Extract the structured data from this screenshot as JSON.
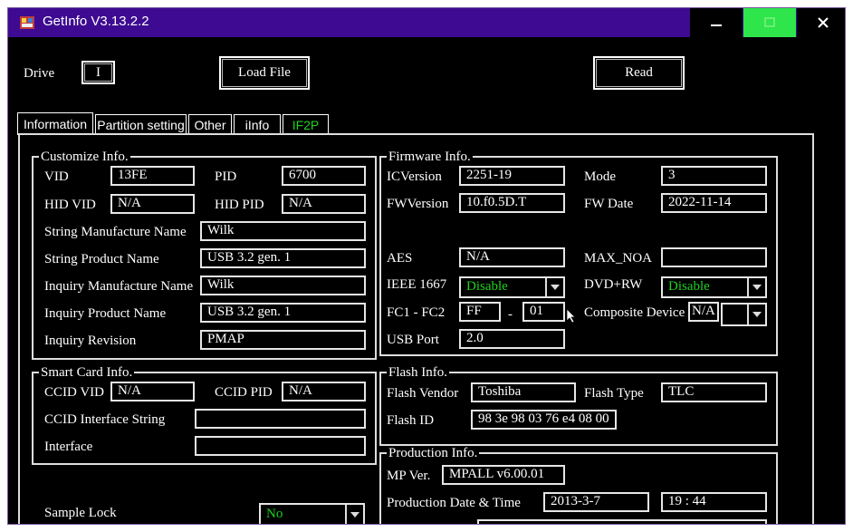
{
  "window": {
    "title": "GetInfo V3.13.2.2"
  },
  "toolbar": {
    "drive_label": "Drive",
    "drive_value": "I",
    "load_file_label": "Load File",
    "read_label": "Read"
  },
  "tabs": [
    "Information",
    "Partition setting",
    "Other",
    "iInfo",
    "IF2P"
  ],
  "customize": {
    "title": "Customize Info.",
    "vid_label": "VID",
    "vid": "13FE",
    "pid_label": "PID",
    "pid": "6700",
    "hid_vid_label": "HID VID",
    "hid_vid": "N/A",
    "hid_pid_label": "HID PID",
    "hid_pid": "N/A",
    "string_mfr_label": "String Manufacture Name",
    "string_mfr": "Wilk",
    "string_product_label": "String Product Name",
    "string_product": "USB 3.2 gen. 1",
    "inquiry_mfr_label": "Inquiry Manufacture Name",
    "inquiry_mfr": "Wilk",
    "inquiry_product_label": "Inquiry Product Name",
    "inquiry_product": "USB 3.2 gen. 1",
    "inquiry_rev_label": "Inquiry Revision",
    "inquiry_rev": "PMAP"
  },
  "firmware": {
    "title": "Firmware Info.",
    "icversion_label": "ICVersion",
    "icversion": "2251-19",
    "mode_label": "Mode",
    "mode": "3",
    "fwversion_label": "FWVersion",
    "fwversion": "10.f0.5D.T",
    "fwdate_label": "FW Date",
    "fwdate": "2022-11-14",
    "aes_label": "AES",
    "aes": "N/A",
    "max_noa_label": "MAX_NOA",
    "max_noa": "",
    "ieee_label": "IEEE 1667",
    "ieee": "Disable",
    "dvdrw_label": "DVD+RW",
    "dvdrw": "Disable",
    "fc_label": "FC1 - FC2",
    "fc1": "FF",
    "fc_sep": "-",
    "fc2": "01",
    "composite_label": "Composite Device",
    "composite": "N/A",
    "composite_combo": "",
    "usbport_label": "USB Port",
    "usbport": "2.0"
  },
  "smartcard": {
    "title": "Smart Card Info.",
    "ccid_vid_label": "CCID VID",
    "ccid_vid": "N/A",
    "ccid_pid_label": "CCID PID",
    "ccid_pid": "N/A",
    "ccid_if_label": "CCID Interface String",
    "ccid_if": "",
    "interface_label": "Interface",
    "interface": ""
  },
  "flash": {
    "title": "Flash Info.",
    "vendor_label": "Flash Vendor",
    "vendor": "Toshiba",
    "type_label": "Flash Type",
    "type": "TLC",
    "id_label": "Flash ID",
    "id": "98 3e 98 03 76 e4 08 00"
  },
  "production": {
    "title": "Production Info.",
    "mpver_label": "MP Ver.",
    "mpver": "MPALL v6.00.01",
    "date_label": "Production Date & Time",
    "date": "2013-3-7",
    "time": "19 : 44"
  },
  "sample_lock": {
    "label": "Sample Lock",
    "value": "No"
  },
  "colors": {
    "titlebar": "#3d0a91",
    "maximize": "#2ee64c",
    "green_text": "#1ed21e"
  }
}
